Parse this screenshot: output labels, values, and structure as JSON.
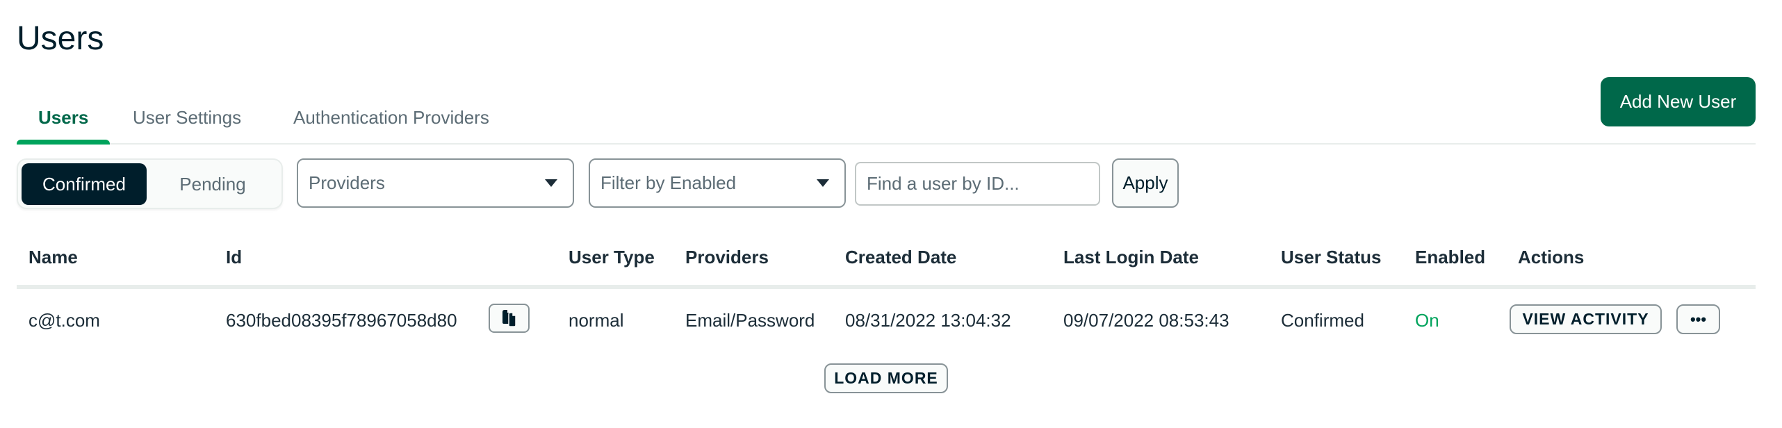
{
  "page": {
    "title": "Users"
  },
  "tabs": [
    {
      "label": "Users",
      "active": true
    },
    {
      "label": "User Settings",
      "active": false
    },
    {
      "label": "Authentication Providers",
      "active": false
    }
  ],
  "header_actions": {
    "add_user_label": "Add New User"
  },
  "filters": {
    "status_toggle": {
      "options": [
        "Confirmed",
        "Pending"
      ],
      "selected": "Confirmed"
    },
    "providers_select": {
      "value": "Providers"
    },
    "enabled_select": {
      "value": "Filter by Enabled"
    },
    "search": {
      "placeholder": "Find a user by ID...",
      "value": "",
      "icon": "search-icon"
    },
    "apply_label": "Apply"
  },
  "table": {
    "columns": [
      "Name",
      "Id",
      "User Type",
      "Providers",
      "Created Date",
      "Last Login Date",
      "User Status",
      "Enabled",
      "Actions"
    ],
    "rows": [
      {
        "name": "c@t.com",
        "id": "630fbed08395f78967058d80",
        "copy_icon": "copy-icon",
        "user_type": "normal",
        "providers": "Email/Password",
        "created_date": "08/31/2022 13:04:32",
        "last_login_date": "09/07/2022 08:53:43",
        "user_status": "Confirmed",
        "enabled": "On",
        "actions": {
          "view_activity_label": "VIEW ACTIVITY",
          "more_label": "•••"
        }
      }
    ],
    "load_more_label": "LOAD MORE"
  },
  "colors": {
    "primary_button": "#00684a",
    "tab_active_indicator": "#00a35c",
    "enabled_on": "#00a35c",
    "segment_active_bg": "#001e2b"
  }
}
